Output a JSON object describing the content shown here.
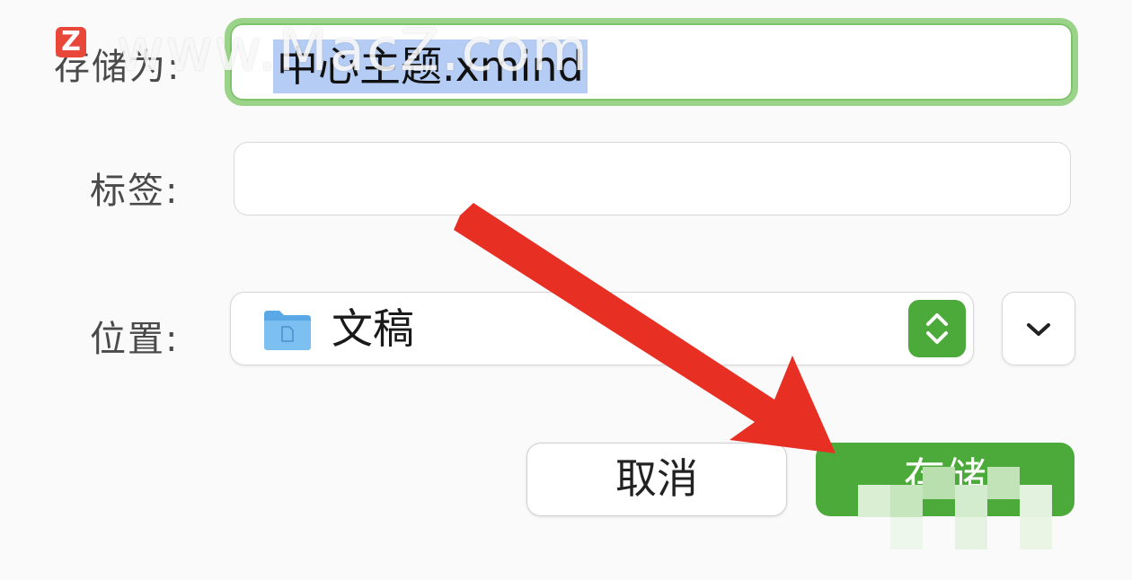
{
  "form": {
    "save_as_label": "存储为:",
    "file_name": "中心主题.xmind",
    "tags_label": "标签:",
    "tags_value": "",
    "location_label": "位置:",
    "location_value": "文稿"
  },
  "buttons": {
    "cancel": "取消",
    "save": "存储"
  },
  "icons": {
    "folder": "folder-icon",
    "stepper": "updown-chevron-icon",
    "expand": "chevron-down-icon",
    "annotation": "red-arrow"
  },
  "watermark": {
    "logo_letter": "Z",
    "text": "www.MacZ.com"
  },
  "colors": {
    "accent_green": "#4caa3a",
    "focus_ring": "#9cd38a",
    "selection": "#b5cdf4",
    "arrow_red": "#e82f24"
  }
}
